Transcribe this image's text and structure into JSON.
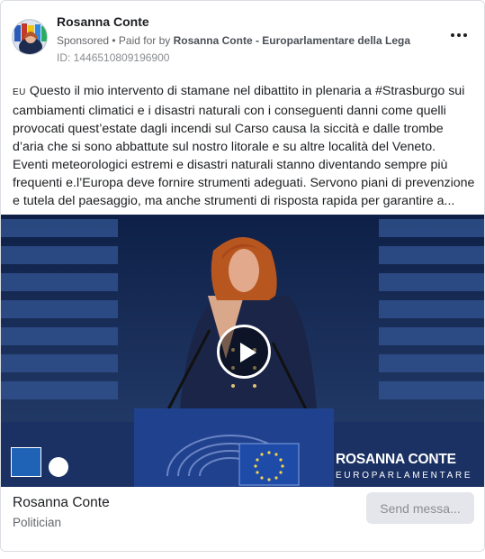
{
  "ad": {
    "advertiser": "Rosanna Conte",
    "sponsored": "Sponsored",
    "separator": " • ",
    "paid_for_prefix": "Paid for by ",
    "paid_for_by": "Rosanna Conte - Europarlamentare della Lega",
    "ad_id": "ID: 1446510809196900",
    "more_icon": "more-options-icon",
    "body_lines": [
      "Questo il mio intervento di stamane nel dibattito in plenaria a #Strasburgo sui cambiamenti climatici e i disastri naturali con i conseguenti danni come quelli provocati quest’estate dagli incendi sul Carso causa la siccità e dalle trombe d’aria che si sono abbattute sul nostro litorale e su altre località del Veneto.",
      "Eventi meteorologici estremi e disastri naturali stanno diventando sempre più frequenti e.l’Europa deve fornire strumenti adeguati. Servono piani di prevenzione e tutela del paesaggio, ma anche strumenti di risposta rapida per garantire a..."
    ],
    "eu_flag_text": "EU",
    "video": {
      "brand_name": "ROSANNA CONTE",
      "brand_subtitle": "EUROPARLAMENTARE",
      "play_icon": "play-icon"
    },
    "footer": {
      "page_name": "Rosanna Conte",
      "page_category": "Politician",
      "cta_label": "Send messa..."
    }
  }
}
